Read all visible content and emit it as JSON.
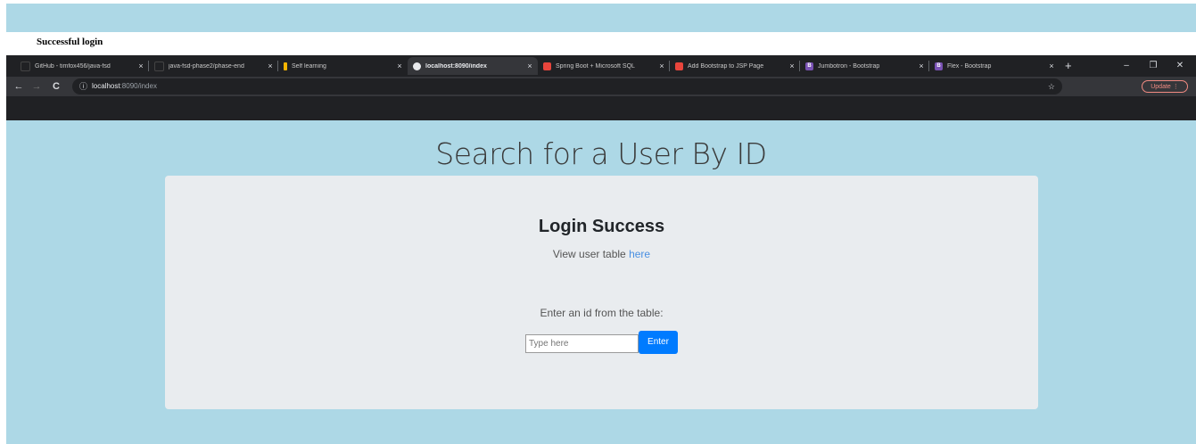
{
  "caption": "Successful login",
  "browser": {
    "tabs": [
      {
        "title": "GitHub - timfox456/java-fsd",
        "favicon": "github-icon",
        "active": false
      },
      {
        "title": "java-fsd-phase2/phase-end",
        "favicon": "github-icon",
        "active": false
      },
      {
        "title": "Self learning",
        "favicon": "learning-icon",
        "active": false
      },
      {
        "title": "localhost:8090/index",
        "favicon": "globe-icon",
        "active": true
      },
      {
        "title": "Spring Boot + Microsoft SQL",
        "favicon": "site-icon",
        "active": false
      },
      {
        "title": "Add Bootstrap to JSP Page",
        "favicon": "site-icon",
        "active": false
      },
      {
        "title": "Jumbotron - Bootstrap",
        "favicon": "bootstrap-icon",
        "active": false
      },
      {
        "title": "Flex - Bootstrap",
        "favicon": "bootstrap-icon",
        "active": false
      }
    ],
    "tab_close": "×",
    "new_tab": "+",
    "window": {
      "minimize": "–",
      "restore": "❐",
      "close": "✕"
    },
    "nav": {
      "back": "←",
      "forward": "→",
      "reload": "C"
    },
    "address": {
      "host": "localhost",
      "path": ":8090/index"
    },
    "update_label": "Update"
  },
  "page": {
    "title": "Search for a User By ID",
    "heading": "Login Success",
    "view_text": "View user table",
    "view_link": "here",
    "prompt": "Enter an id from the table:",
    "input_placeholder": "Type here",
    "button_label": "Enter"
  },
  "colors": {
    "page_bg": "#add8e6",
    "jumbotron_bg": "#e9ecef",
    "button": "#007bff",
    "link": "#4a90e2",
    "browser_chrome": "#202124"
  }
}
